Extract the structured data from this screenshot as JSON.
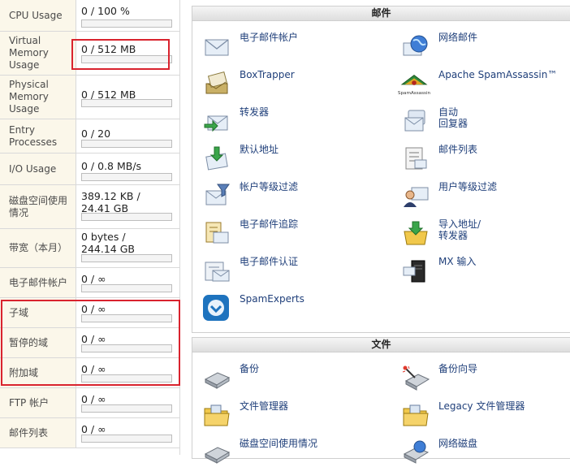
{
  "stats": [
    {
      "label": [
        "CPU Usage"
      ],
      "value": "0 / 100 %",
      "fraction": 0
    },
    {
      "label": [
        "Virtual",
        "Memory",
        "Usage"
      ],
      "value": "0 / 512 MB",
      "fraction": 0
    },
    {
      "label": [
        "Physical",
        "Memory",
        "Usage"
      ],
      "value": "0 / 512 MB",
      "fraction": 0
    },
    {
      "label": [
        "Entry",
        "Processes"
      ],
      "value": "0 / 20",
      "fraction": 0
    },
    {
      "label": [
        "I/O Usage"
      ],
      "value": "0 / 0.8 MB/s",
      "fraction": 0
    },
    {
      "label": [
        "磁盘空间使用",
        "情况"
      ],
      "value": [
        "389.12 KB /",
        "24.41 GB"
      ],
      "fraction": 0.0002
    },
    {
      "label": [
        "带宽（本月）"
      ],
      "value": [
        "0 bytes /",
        "244.14 GB"
      ],
      "fraction": 0
    },
    {
      "label": [
        "电子邮件帐户"
      ],
      "value": "0 / ∞",
      "fraction": 0
    },
    {
      "label": [
        "子域"
      ],
      "value": "0 / ∞",
      "fraction": 0
    },
    {
      "label": [
        "暂停的域"
      ],
      "value": "0 / ∞",
      "fraction": 0
    },
    {
      "label": [
        "附加域"
      ],
      "value": "0 / ∞",
      "fraction": 0
    },
    {
      "label": [
        "FTP 帐户"
      ],
      "value": "0 / ∞",
      "fraction": 0
    },
    {
      "label": [
        "邮件列表"
      ],
      "value": "0 / ∞",
      "fraction": 0
    }
  ],
  "mail_panel": {
    "title": "邮件",
    "items": [
      {
        "label": [
          "电子邮件帐户"
        ],
        "icon": "envelope-icon"
      },
      {
        "label": [
          "网络邮件"
        ],
        "icon": "webmail-globe-icon"
      },
      {
        "label": [
          "BoxTrapper"
        ],
        "icon": "boxtrapper-icon"
      },
      {
        "label": [
          "Apache SpamAssassin™"
        ],
        "icon": "spamassassin-icon",
        "icon_caption": "SpamAssassin"
      },
      {
        "label": [
          "转发器"
        ],
        "icon": "forwarder-icon"
      },
      {
        "label": [
          "自动",
          "回复器"
        ],
        "icon": "autoresponder-icon"
      },
      {
        "label": [
          "默认地址"
        ],
        "icon": "default-address-icon"
      },
      {
        "label": [
          "邮件列表"
        ],
        "icon": "mailing-list-icon"
      },
      {
        "label": [
          "帐户等级过滤"
        ],
        "icon": "account-filter-icon"
      },
      {
        "label": [
          "用户等级过滤"
        ],
        "icon": "user-filter-icon"
      },
      {
        "label": [
          "电子邮件追踪"
        ],
        "icon": "email-trace-icon"
      },
      {
        "label": [
          "导入地址/",
          "转发器"
        ],
        "icon": "import-icon"
      },
      {
        "label": [
          "电子邮件认证"
        ],
        "icon": "email-auth-icon"
      },
      {
        "label": [
          "MX 输入"
        ],
        "icon": "mx-entry-icon"
      },
      {
        "label": [
          "SpamExperts"
        ],
        "icon": "spamexperts-icon"
      }
    ]
  },
  "files_panel": {
    "title": "文件",
    "items": [
      {
        "label": [
          "备份"
        ],
        "icon": "backup-icon"
      },
      {
        "label": [
          "备份向导"
        ],
        "icon": "backup-wizard-icon"
      },
      {
        "label": [
          "文件管理器"
        ],
        "icon": "file-manager-icon"
      },
      {
        "label": [
          "Legacy 文件管理器"
        ],
        "icon": "legacy-file-manager-icon"
      },
      {
        "label": [
          "磁盘空间使用情况"
        ],
        "icon": "disk-usage-icon"
      },
      {
        "label": [
          "网络磁盘"
        ],
        "icon": "web-disk-icon"
      }
    ]
  },
  "colors": {
    "link": "#1f3f7a",
    "label_bg": "#fbf7ea",
    "highlight": "#d9232e"
  }
}
